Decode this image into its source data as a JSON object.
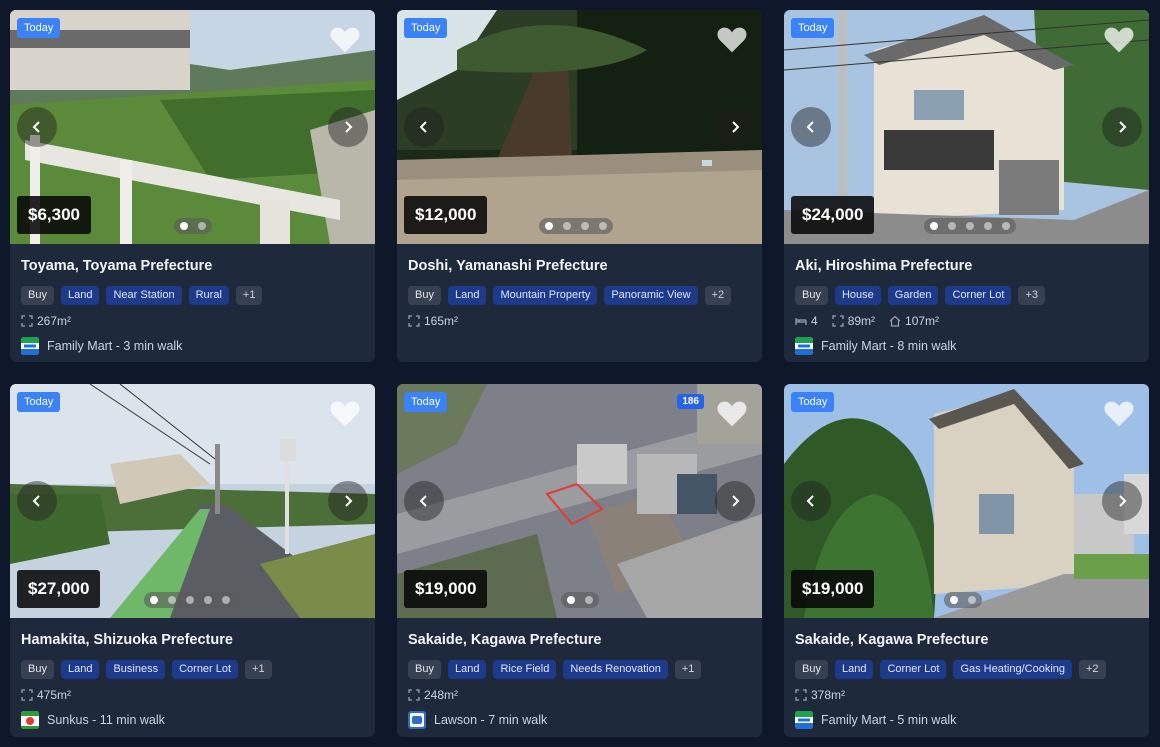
{
  "listings": [
    {
      "badge": "Today",
      "price": "$6,300",
      "title": "Toyama, Toyama Prefecture",
      "tags": [
        "Buy",
        "Land",
        "Near Station",
        "Rural",
        "+1"
      ],
      "beds": "",
      "area": "267m²",
      "floor": "",
      "store": "Family Mart - 3 min walk",
      "store_logo": "familymart-logo",
      "photo_count": 2,
      "active_photo": 0,
      "image_badge": ""
    },
    {
      "badge": "Today",
      "price": "$12,000",
      "title": "Doshi, Yamanashi Prefecture",
      "tags": [
        "Buy",
        "Land",
        "Mountain Property",
        "Panoramic View",
        "+2"
      ],
      "beds": "",
      "area": "165m²",
      "floor": "",
      "store": "",
      "store_logo": "",
      "photo_count": 4,
      "active_photo": 0,
      "image_badge": ""
    },
    {
      "badge": "Today",
      "price": "$24,000",
      "title": "Aki, Hiroshima Prefecture",
      "tags": [
        "Buy",
        "House",
        "Garden",
        "Corner Lot",
        "+3"
      ],
      "beds": "4",
      "area": "89m²",
      "floor": "107m²",
      "store": "Family Mart - 8 min walk",
      "store_logo": "familymart-logo",
      "photo_count": 5,
      "active_photo": 0,
      "image_badge": ""
    },
    {
      "badge": "Today",
      "price": "$27,000",
      "title": "Hamakita, Shizuoka Prefecture",
      "tags": [
        "Buy",
        "Land",
        "Business",
        "Corner Lot",
        "+1"
      ],
      "beds": "",
      "area": "475m²",
      "floor": "",
      "store": "Sunkus - 11 min walk",
      "store_logo": "sunkus-logo",
      "photo_count": 5,
      "active_photo": 0,
      "image_badge": ""
    },
    {
      "badge": "Today",
      "price": "$19,000",
      "title": "Sakaide, Kagawa Prefecture",
      "tags": [
        "Buy",
        "Land",
        "Rice Field",
        "Needs Renovation",
        "+1"
      ],
      "beds": "",
      "area": "248m²",
      "floor": "",
      "store": "Lawson - 7 min walk",
      "store_logo": "lawson-logo",
      "photo_count": 2,
      "active_photo": 0,
      "image_badge": "186"
    },
    {
      "badge": "Today",
      "price": "$19,000",
      "title": "Sakaide, Kagawa Prefecture",
      "tags": [
        "Buy",
        "Land",
        "Corner Lot",
        "Gas Heating/Cooking",
        "+2"
      ],
      "beds": "",
      "area": "378m²",
      "floor": "",
      "store": "Family Mart - 5 min walk",
      "store_logo": "familymart-logo",
      "photo_count": 2,
      "active_photo": 0,
      "image_badge": ""
    }
  ]
}
